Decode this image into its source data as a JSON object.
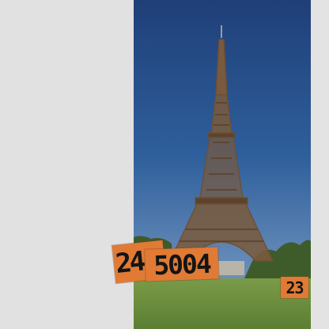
{
  "photo": {
    "subject": "tower-photo",
    "sky_color": "#2f5f9c",
    "grass_color": "#6c8f3e",
    "tower_color": "#7a5a3c"
  },
  "tags": {
    "tag_a": "24",
    "tag_b": "5004",
    "tag_c": "23",
    "color": "#e07a35"
  }
}
